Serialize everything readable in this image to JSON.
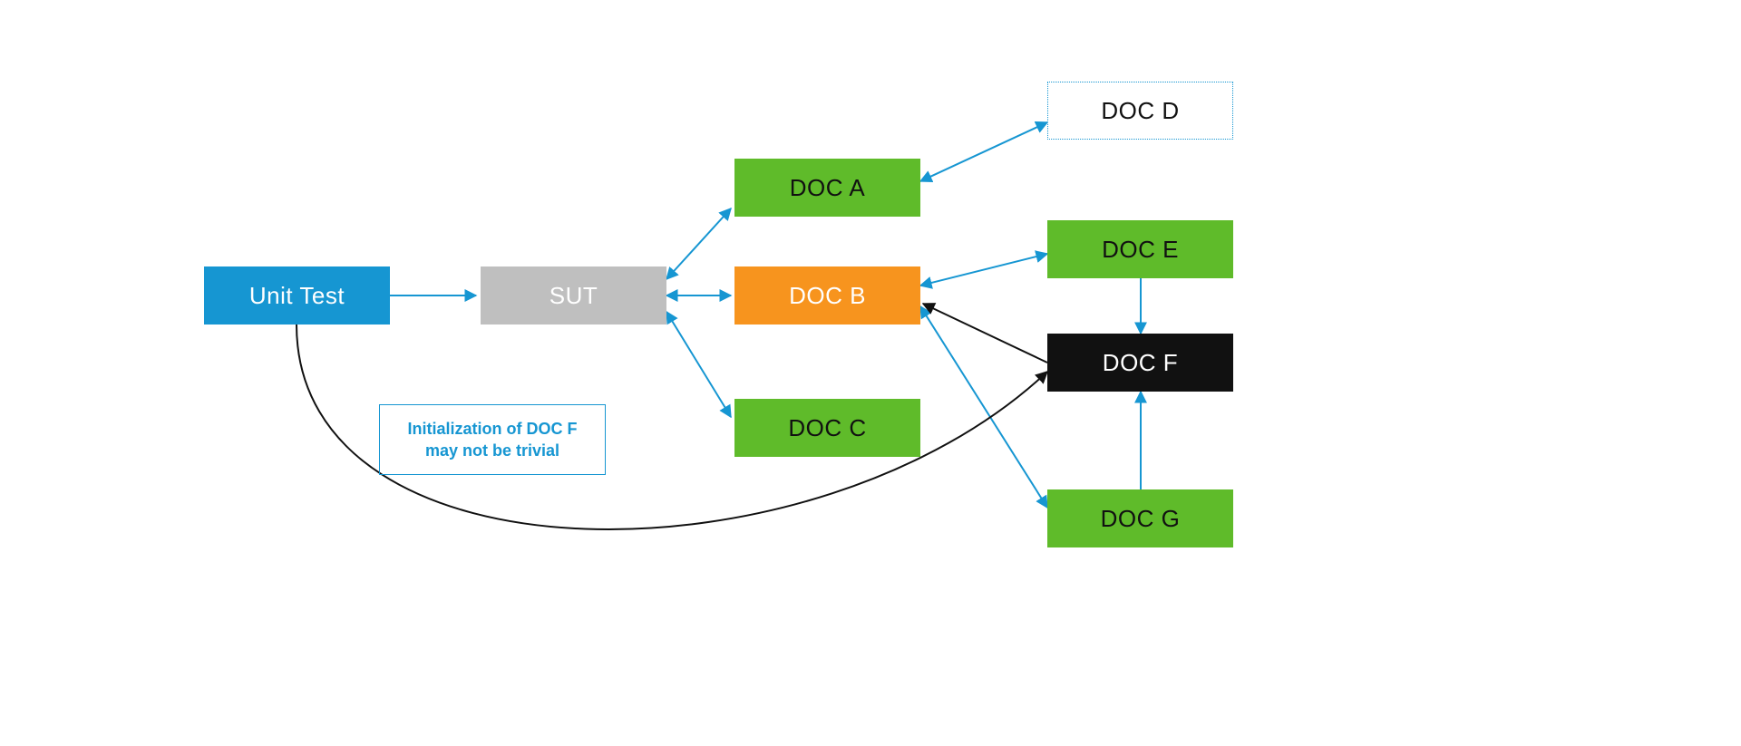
{
  "nodes": {
    "unit_test": {
      "label": "Unit Test",
      "bg": "#1696d2",
      "fg": "#ffffff",
      "border": "none"
    },
    "sut": {
      "label": "SUT",
      "bg": "#bfbfbf",
      "fg": "#ffffff",
      "border": "none"
    },
    "doc_a": {
      "label": "DOC A",
      "bg": "#5fbb2a",
      "fg": "#111111",
      "border": "none"
    },
    "doc_b": {
      "label": "DOC B",
      "bg": "#f7941e",
      "fg": "#ffffff",
      "border": "none"
    },
    "doc_c": {
      "label": "DOC C",
      "bg": "#5fbb2a",
      "fg": "#111111",
      "border": "none"
    },
    "doc_d": {
      "label": "DOC D",
      "bg": "#ffffff",
      "fg": "#111111",
      "border": "1px dotted #1696d2"
    },
    "doc_e": {
      "label": "DOC E",
      "bg": "#5fbb2a",
      "fg": "#111111",
      "border": "none"
    },
    "doc_f": {
      "label": "DOC F",
      "bg": "#111111",
      "fg": "#ffffff",
      "border": "none"
    },
    "doc_g": {
      "label": "DOC G",
      "bg": "#5fbb2a",
      "fg": "#111111",
      "border": "none"
    }
  },
  "note_text": "Initialization of DOC F\nmay not be trivial",
  "colors": {
    "arrow_blue": "#1696d2",
    "arrow_black": "#111111",
    "note_border": "#1696d2",
    "note_text": "#1696d2"
  }
}
